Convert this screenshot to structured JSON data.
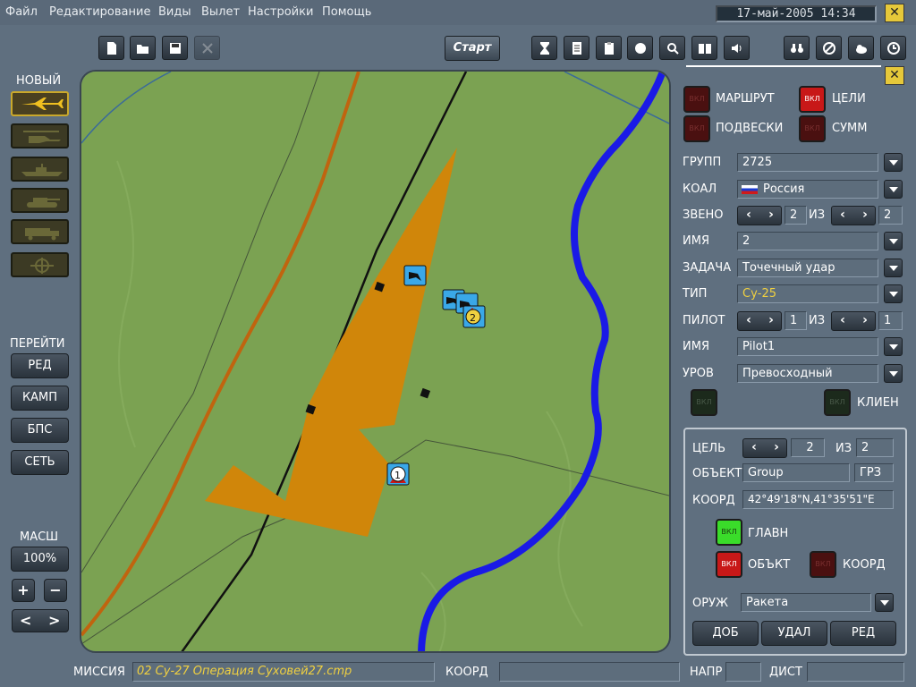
{
  "menu": [
    "Файл",
    "Редактирование",
    "Виды",
    "Вылет",
    "Настройки",
    "Помощь"
  ],
  "clock": "17-май-2005   14:34",
  "close_label": "✕",
  "toolbar": {
    "start_label": "Старт"
  },
  "left_panel": {
    "new_label": "НОВЫЙ",
    "goto_label": "ПЕРЕЙТИ",
    "nav_buttons": [
      "РЕД",
      "КАМП",
      "БПС",
      "СЕТЬ"
    ],
    "scale_label": "МАСШ",
    "scale_value": "100%",
    "plus": "+",
    "minus": "−",
    "prev": "<",
    "next": ">"
  },
  "right_panel": {
    "route_label": "МАРШРУТ",
    "targets_label": "ЦЕЛИ",
    "loadout_label": "ПОДВЕСКИ",
    "summ_label": "СУММ",
    "toggle_text": "ВКЛ",
    "group_label": "ГРУПП",
    "group_value": "2725",
    "coal_label": "КОАЛ",
    "coal_value": "Россия",
    "flight_label": "ЗВЕНО",
    "flight_value": "2",
    "of_label": "ИЗ",
    "flight_total": "2",
    "name_label": "ИМЯ",
    "name_value": "2",
    "task_label": "ЗАДАЧА",
    "task_value": "Точечный удар",
    "type_label": "ТИП",
    "type_value": "Су-25",
    "pilot_label": "ПИЛОТ",
    "pilot_value": "1",
    "pilot_total": "1",
    "pilot_name_label": "ИМЯ",
    "pilot_name_value": "Pilot1",
    "level_label": "УРОВ",
    "level_value": "Превосходный",
    "client_label": "КЛИЕН",
    "target": {
      "target_label": "ЦЕЛЬ",
      "target_value": "2",
      "of_label": "ИЗ",
      "target_total": "2",
      "object_label": "ОБЪЕКТ",
      "object_value": "Group",
      "object_button": "ГРЗ",
      "coord_label": "КООРД",
      "coord_value": "42°49'18\"N,41°35'51\"E",
      "main_label": "ГЛАВН",
      "obj_toggle_label": "ОБЪКТ",
      "coord_toggle_label": "КООРД",
      "weapon_label": "ОРУЖ",
      "weapon_value": "Ракета",
      "add_button": "ДОБ",
      "delete_button": "УДАЛ",
      "edit_button": "РЕД"
    }
  },
  "status_bar": {
    "mission_label": "МИССИЯ",
    "mission_value": "02 Су-27 Операция Суховей27.cmp",
    "coord_label": "КООРД",
    "heading_label": "НАПР",
    "distance_label": "ДИСТ"
  },
  "map": {
    "waypoint_1": "1",
    "waypoint_2": "2"
  },
  "colors": {
    "map_green": "#7ba252",
    "target_area": "#d0860a",
    "river": "#1a1ae6",
    "road": "#c0640f",
    "accent_yellow": "#f0d040"
  }
}
